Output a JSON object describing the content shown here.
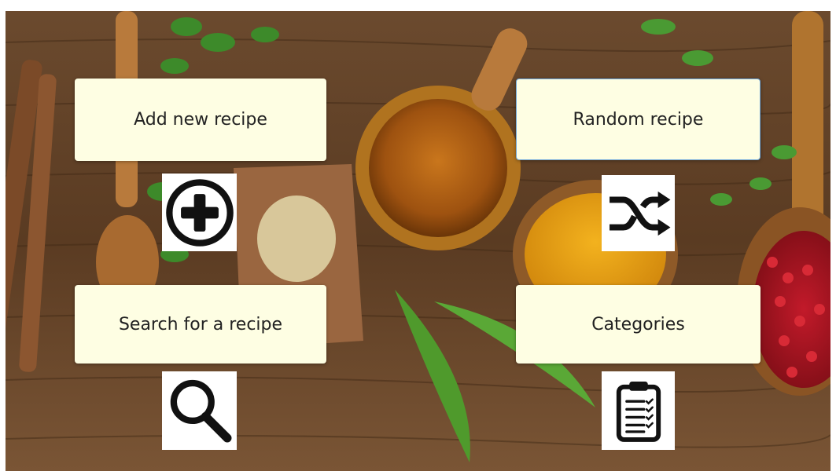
{
  "menu": {
    "add_recipe_label": "Add new recipe",
    "random_recipe_label": "Random recipe",
    "search_recipe_label": "Search for a recipe",
    "categories_label": "Categories"
  },
  "icons": {
    "add": "plus-circle-icon",
    "random": "shuffle-icon",
    "search": "magnifier-icon",
    "categories": "clipboard-list-icon"
  },
  "colors": {
    "tile_background": "#fefee3",
    "icon_color": "#111111",
    "focus_border": "#6fa8dc"
  }
}
